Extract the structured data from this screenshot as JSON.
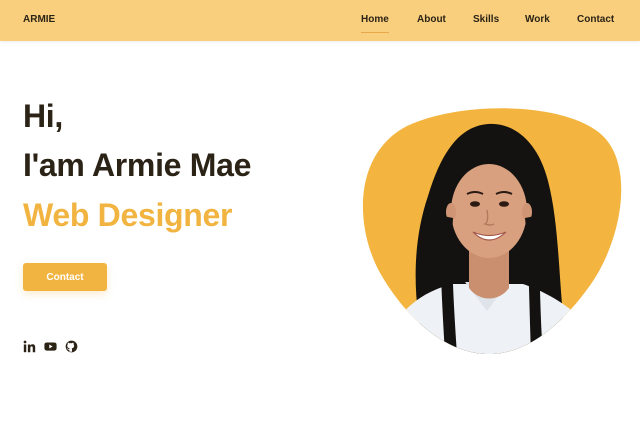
{
  "header": {
    "logo": "ARMIE",
    "nav": [
      {
        "label": "Home",
        "active": true
      },
      {
        "label": "About",
        "active": false
      },
      {
        "label": "Skills",
        "active": false
      },
      {
        "label": "Work",
        "active": false
      },
      {
        "label": "Contact",
        "active": false
      }
    ]
  },
  "hero": {
    "greeting": "Hi,",
    "name_line": "I'am Armie Mae",
    "title": "Web Designer",
    "contact_button": "Contact"
  },
  "social": [
    {
      "icon": "linkedin-icon"
    },
    {
      "icon": "youtube-icon"
    },
    {
      "icon": "github-icon"
    }
  ],
  "colors": {
    "header_bg": "#f9cf7e",
    "accent": "#f2b440",
    "text_dark": "#2b2316"
  }
}
